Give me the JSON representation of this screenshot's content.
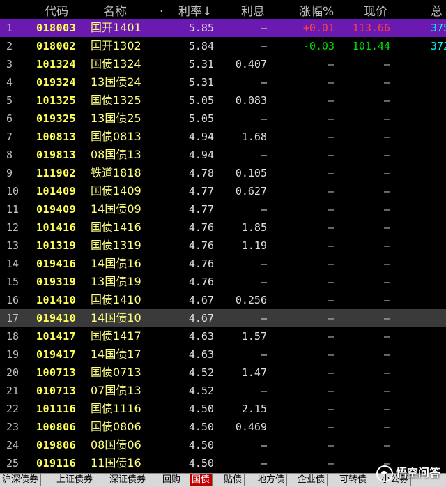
{
  "header": {
    "code": "代码",
    "name": "名称",
    "dot": ".",
    "rate": "利率↓",
    "interest": "利息",
    "change": "涨幅%",
    "price": "现价",
    "total": "总"
  },
  "rows": [
    {
      "idx": "1",
      "code": "018003",
      "name": "国开1401",
      "rate": "5.85",
      "interest": "–",
      "change": "+0.01",
      "price": "113.66",
      "total": "375",
      "dir": "up"
    },
    {
      "idx": "2",
      "code": "018002",
      "name": "国开1302",
      "rate": "5.84",
      "interest": "–",
      "change": "-0.03",
      "price": "101.44",
      "total": "372",
      "dir": "down"
    },
    {
      "idx": "3",
      "code": "101324",
      "name": "国债1324",
      "rate": "5.31",
      "interest": "0.407",
      "change": "–",
      "price": "–",
      "total": ""
    },
    {
      "idx": "4",
      "code": "019324",
      "name": "13国债24",
      "rate": "5.31",
      "interest": "–",
      "change": "–",
      "price": "–",
      "total": ""
    },
    {
      "idx": "5",
      "code": "101325",
      "name": "国债1325",
      "rate": "5.05",
      "interest": "0.083",
      "change": "–",
      "price": "–",
      "total": ""
    },
    {
      "idx": "6",
      "code": "019325",
      "name": "13国债25",
      "rate": "5.05",
      "interest": "–",
      "change": "–",
      "price": "–",
      "total": ""
    },
    {
      "idx": "7",
      "code": "100813",
      "name": "国债0813",
      "rate": "4.94",
      "interest": "1.68",
      "change": "–",
      "price": "–",
      "total": ""
    },
    {
      "idx": "8",
      "code": "019813",
      "name": "08国债13",
      "rate": "4.94",
      "interest": "–",
      "change": "–",
      "price": "–",
      "total": ""
    },
    {
      "idx": "9",
      "code": "111902",
      "name": "铁道1818",
      "rate": "4.78",
      "interest": "0.105",
      "change": "–",
      "price": "–",
      "total": ""
    },
    {
      "idx": "10",
      "code": "101409",
      "name": "国债1409",
      "rate": "4.77",
      "interest": "0.627",
      "change": "–",
      "price": "–",
      "total": ""
    },
    {
      "idx": "11",
      "code": "019409",
      "name": "14国债09",
      "rate": "4.77",
      "interest": "–",
      "change": "–",
      "price": "–",
      "total": ""
    },
    {
      "idx": "12",
      "code": "101416",
      "name": "国债1416",
      "rate": "4.76",
      "interest": "1.85",
      "change": "–",
      "price": "–",
      "total": ""
    },
    {
      "idx": "13",
      "code": "101319",
      "name": "国债1319",
      "rate": "4.76",
      "interest": "1.19",
      "change": "–",
      "price": "–",
      "total": ""
    },
    {
      "idx": "14",
      "code": "019416",
      "name": "14国债16",
      "rate": "4.76",
      "interest": "–",
      "change": "–",
      "price": "–",
      "total": ""
    },
    {
      "idx": "15",
      "code": "019319",
      "name": "13国债19",
      "rate": "4.76",
      "interest": "–",
      "change": "–",
      "price": "–",
      "total": ""
    },
    {
      "idx": "16",
      "code": "101410",
      "name": "国债1410",
      "rate": "4.67",
      "interest": "0.256",
      "change": "–",
      "price": "–",
      "total": ""
    },
    {
      "idx": "17",
      "code": "019410",
      "name": "14国债10",
      "rate": "4.67",
      "interest": "–",
      "change": "–",
      "price": "–",
      "total": ""
    },
    {
      "idx": "18",
      "code": "101417",
      "name": "国债1417",
      "rate": "4.63",
      "interest": "1.57",
      "change": "–",
      "price": "–",
      "total": ""
    },
    {
      "idx": "19",
      "code": "019417",
      "name": "14国债17",
      "rate": "4.63",
      "interest": "–",
      "change": "–",
      "price": "–",
      "total": ""
    },
    {
      "idx": "20",
      "code": "100713",
      "name": "国债0713",
      "rate": "4.52",
      "interest": "1.47",
      "change": "–",
      "price": "–",
      "total": ""
    },
    {
      "idx": "21",
      "code": "010713",
      "name": "07国债13",
      "rate": "4.52",
      "interest": "–",
      "change": "–",
      "price": "–",
      "total": ""
    },
    {
      "idx": "22",
      "code": "101116",
      "name": "国债1116",
      "rate": "4.50",
      "interest": "2.15",
      "change": "–",
      "price": "–",
      "total": ""
    },
    {
      "idx": "23",
      "code": "100806",
      "name": "国债0806",
      "rate": "4.50",
      "interest": "0.469",
      "change": "–",
      "price": "–",
      "total": ""
    },
    {
      "idx": "24",
      "code": "019806",
      "name": "08国债06",
      "rate": "4.50",
      "interest": "–",
      "change": "–",
      "price": "–",
      "total": ""
    },
    {
      "idx": "25",
      "code": "019116",
      "name": "11国债16",
      "rate": "4.50",
      "interest": "–",
      "change": "–",
      "price": "–",
      "total": ""
    }
  ],
  "tabs": [
    "沪深债券",
    "上证债券",
    "深证债券",
    "回购",
    "国债",
    "贴债",
    "地方债",
    "企业债",
    "可转债",
    "小公募"
  ],
  "active_tab": "国债",
  "watermark": "悟空问答",
  "colors": {
    "selected_row": "#6a1ab0",
    "highlight_row": "#3a3a3a",
    "code": "#ffff55",
    "up": "#ff4040",
    "down": "#00e000",
    "total": "#00ffff",
    "active_tab": "#c00000"
  }
}
